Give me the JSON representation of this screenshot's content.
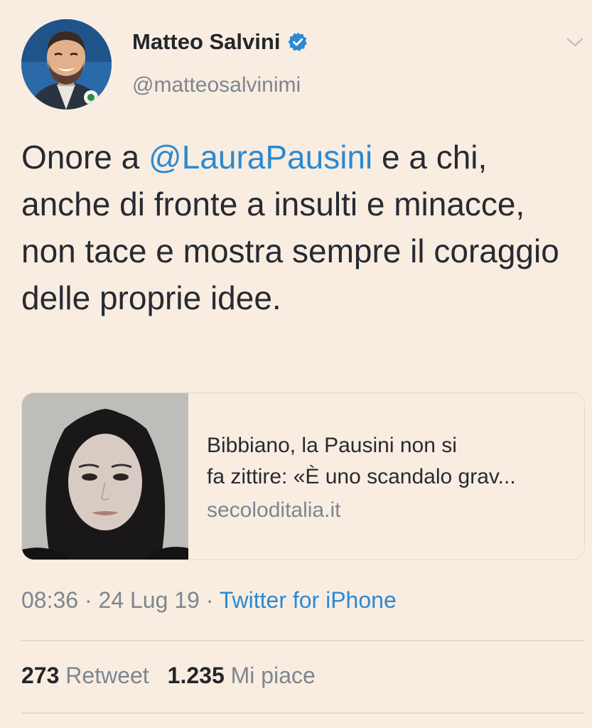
{
  "author": {
    "name": "Matteo Salvini",
    "handle": "@matteosalvinimi",
    "avatar_icon": "profile-photo",
    "verified_icon": "verified-badge-icon"
  },
  "tweet": {
    "text_before": "Onore a ",
    "mention": "@LauraPausini",
    "text_after": " e a chi, anche di fronte a insulti e minacce, non tace e mostra sempre il coraggio delle proprie idee."
  },
  "card": {
    "title_line1": "Bibbiano, la Pausini non si",
    "title_line2": "fa zittire: «È uno scandalo grav...",
    "domain": "secoloditalia.it",
    "thumbnail_icon": "article-photo"
  },
  "meta": {
    "time": "08:36",
    "sep1": " · ",
    "date": "24 Lug 19",
    "sep2": " · ",
    "source": "Twitter for iPhone"
  },
  "stats": {
    "retweets_count": "273",
    "retweets_label": "Retweet",
    "likes_count": "1.235",
    "likes_label": "Mi piace"
  },
  "colors": {
    "background": "#f9ede1",
    "link": "#2b8ad2",
    "secondary_text": "#7d8690",
    "verified": "#2b8ad2"
  }
}
